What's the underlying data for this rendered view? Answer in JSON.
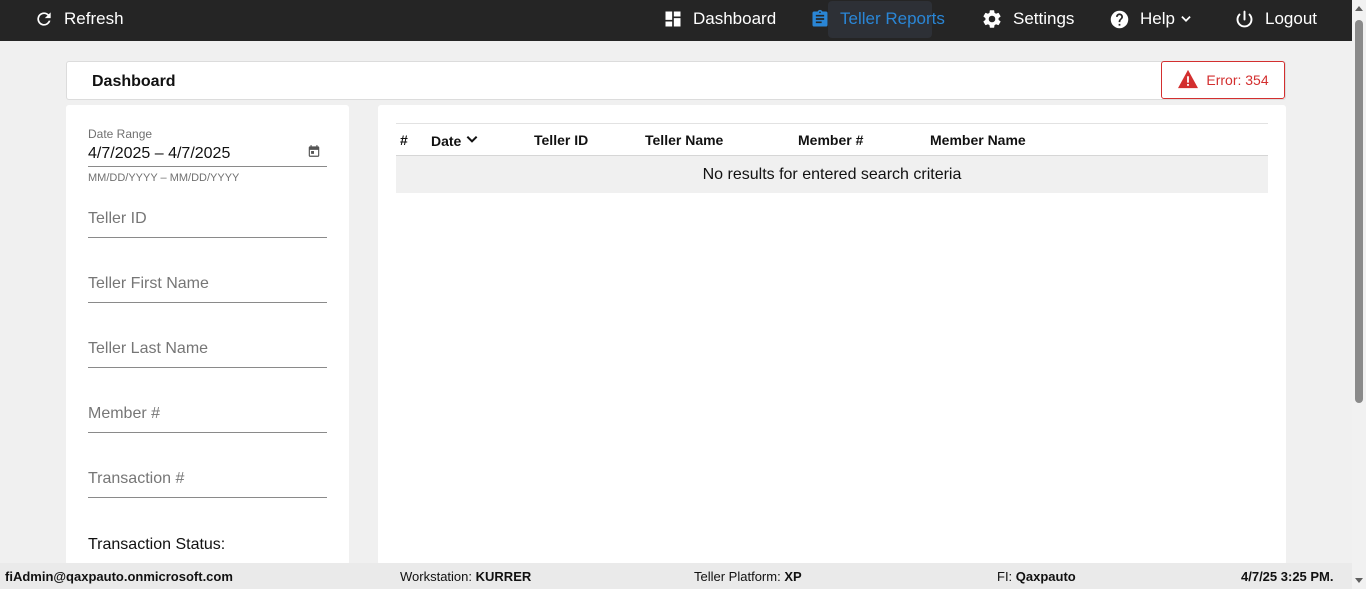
{
  "topbar": {
    "refresh_label": "Refresh",
    "nav": {
      "dashboard": "Dashboard",
      "teller_reports": "Teller Reports",
      "settings": "Settings",
      "help": "Help",
      "logout": "Logout"
    },
    "active_color": "#2a86d6"
  },
  "header": {
    "title": "Dashboard",
    "error_label": "Error: 354",
    "error_color": "#d32f2f"
  },
  "filters": {
    "date_range": {
      "label": "Date Range",
      "value": "4/7/2025 – 4/7/2025",
      "hint": "MM/DD/YYYY – MM/DD/YYYY"
    },
    "teller_id_placeholder": "Teller ID",
    "teller_first_name_placeholder": "Teller First Name",
    "teller_last_name_placeholder": "Teller Last Name",
    "member_number_placeholder": "Member #",
    "transaction_number_placeholder": "Transaction #",
    "transaction_status_label": "Transaction Status:"
  },
  "table": {
    "columns": [
      "#",
      "Date",
      "Teller ID",
      "Teller Name",
      "Member #",
      "Member Name"
    ],
    "sort_column": "Date",
    "empty_message": "No results for entered search criteria"
  },
  "footer": {
    "user": "fiAdmin@qaxpauto.onmicrosoft.com",
    "workstation_label": "Workstation:",
    "workstation_value": "KURRER",
    "platform_label": "Teller Platform:",
    "platform_value": "XP",
    "fi_label": "FI:",
    "fi_value": "Qaxpauto",
    "datetime": "4/7/25 3:25 PM."
  }
}
